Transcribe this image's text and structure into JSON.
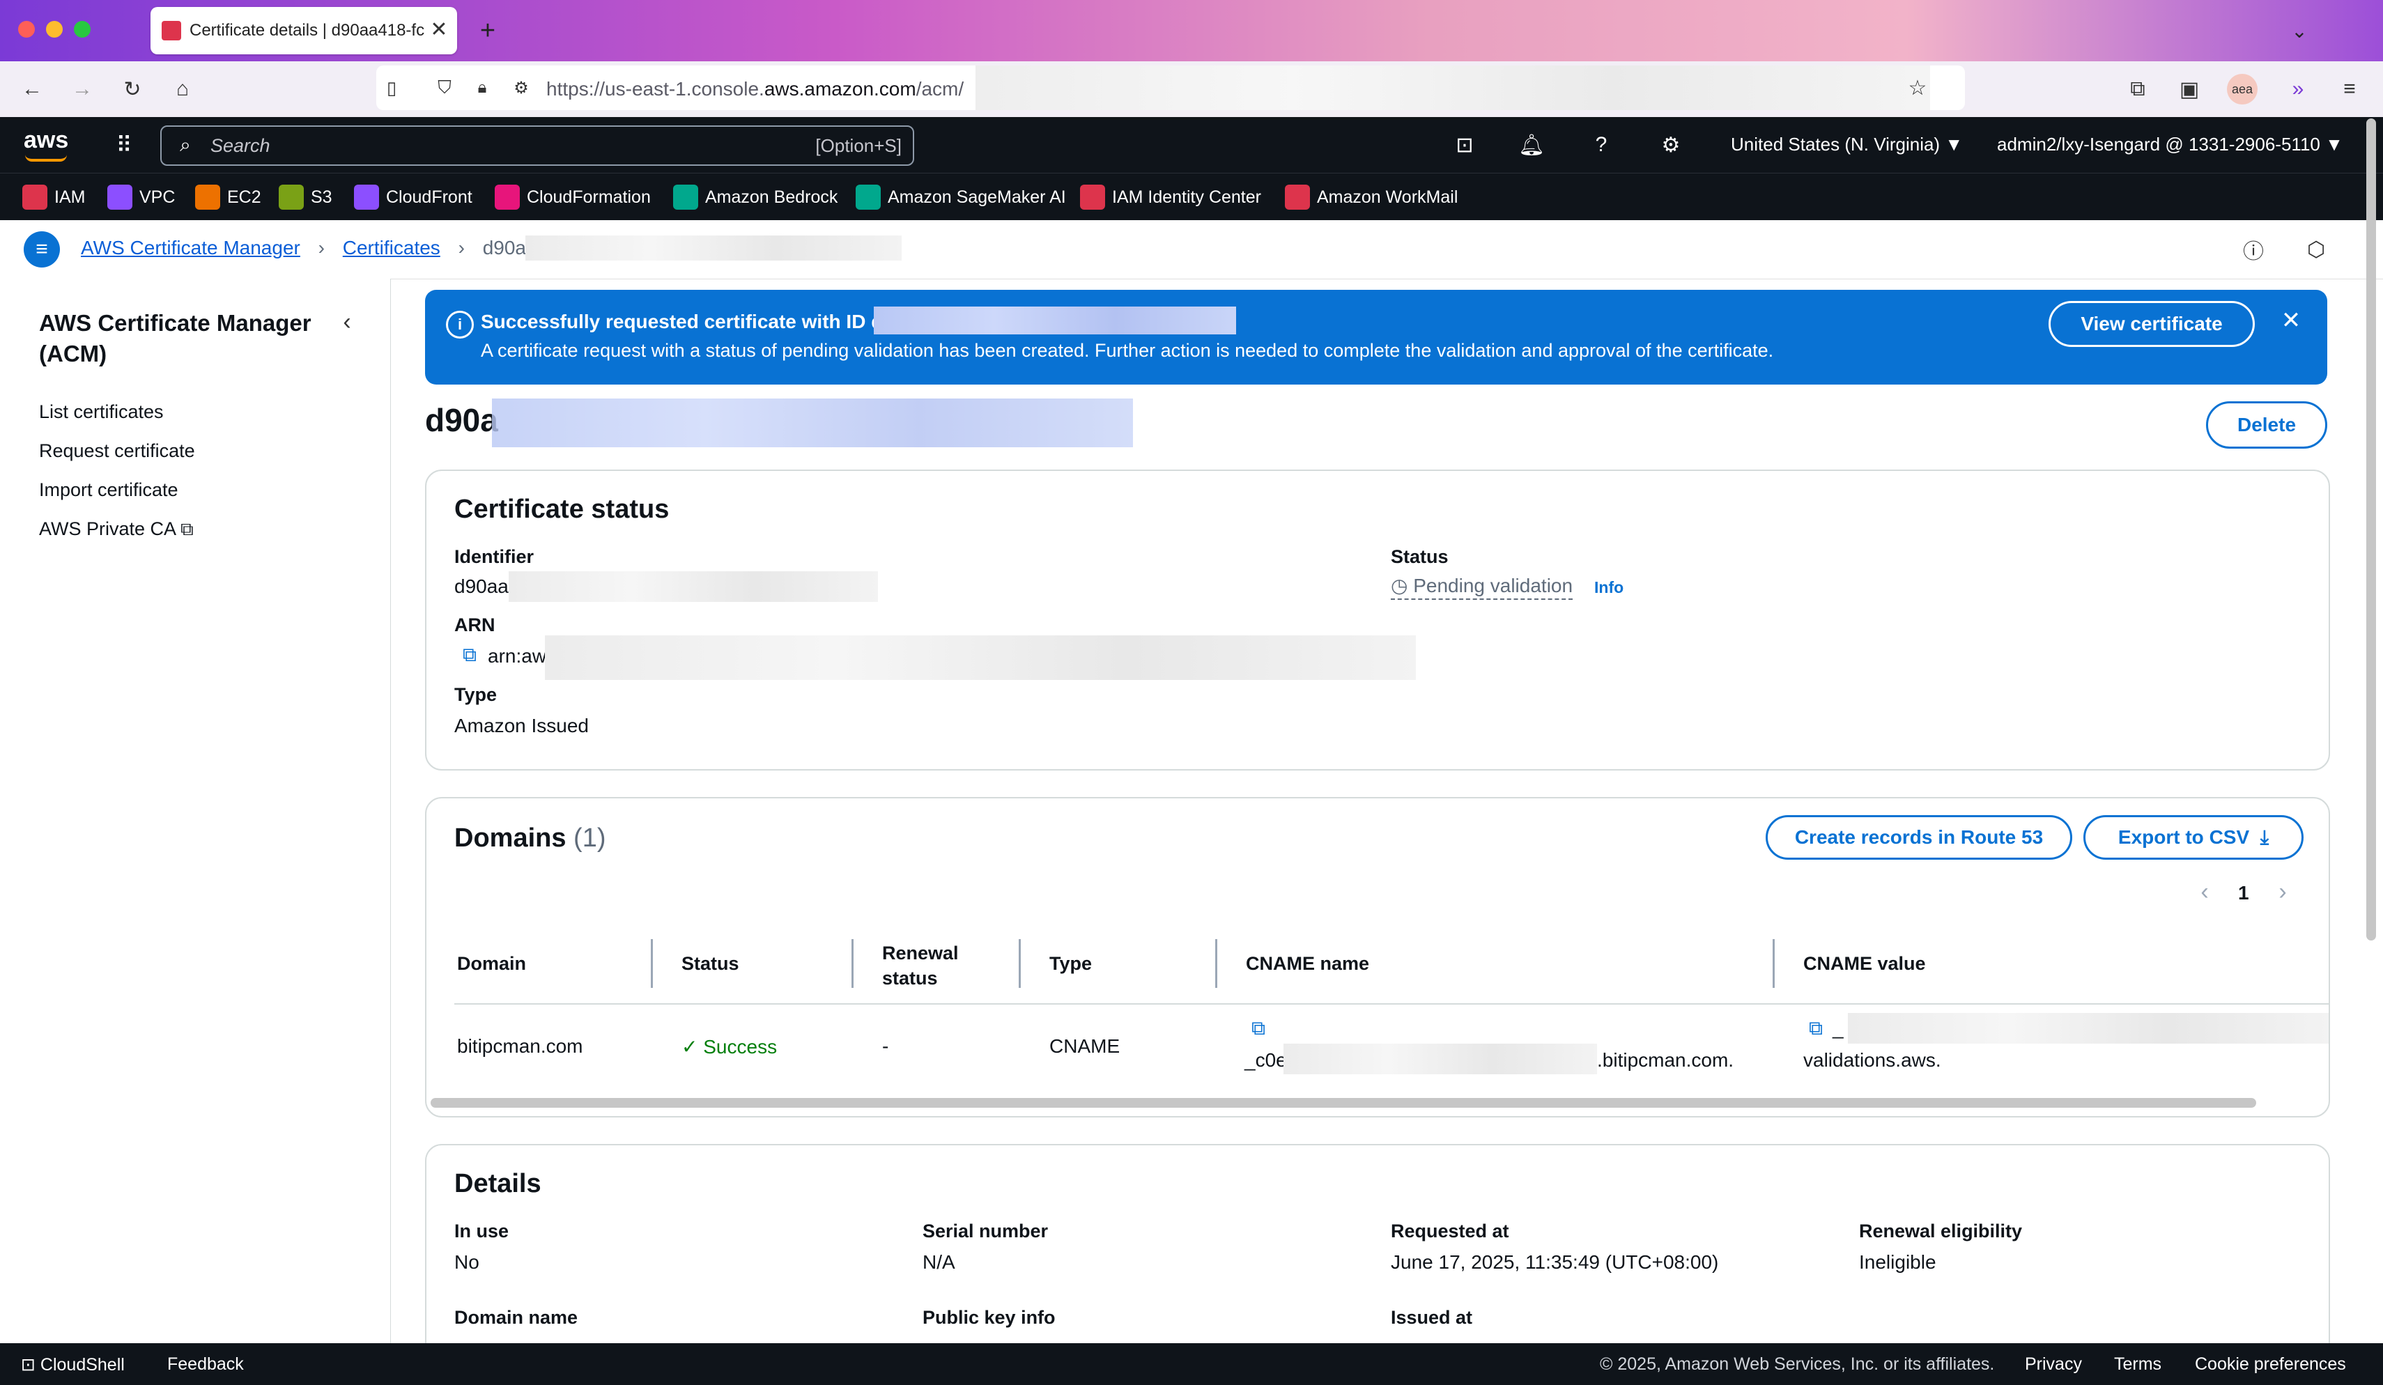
{
  "browser": {
    "tab_title": "Certificate details | d90aa418-fc",
    "url_prefix": "https://us-east-1.console.",
    "url_domain": "aws.amazon.com",
    "url_path": "/acm/"
  },
  "aws_nav": {
    "search_placeholder": "Search",
    "search_shortcut": "[Option+S]",
    "region": "United States (N. Virginia)",
    "account": "admin2/lxy-Isengard @ 1331-2906-5110"
  },
  "favorites": [
    {
      "label": "IAM",
      "color": "#dd344c"
    },
    {
      "label": "VPC",
      "color": "#8c4fff"
    },
    {
      "label": "EC2",
      "color": "#ed7100"
    },
    {
      "label": "S3",
      "color": "#7aa116"
    },
    {
      "label": "CloudFront",
      "color": "#8c4fff"
    },
    {
      "label": "CloudFormation",
      "color": "#e7157b"
    },
    {
      "label": "Amazon Bedrock",
      "color": "#01a88d"
    },
    {
      "label": "Amazon SageMaker AI",
      "color": "#01a88d"
    },
    {
      "label": "IAM Identity Center",
      "color": "#dd344c"
    },
    {
      "label": "Amazon WorkMail",
      "color": "#dd344c"
    }
  ],
  "breadcrumb": {
    "service": "AWS Certificate Manager",
    "section": "Certificates",
    "current": "d90aa"
  },
  "sidebar": {
    "title": "AWS Certificate Manager (ACM)",
    "items": [
      "List certificates",
      "Request certificate",
      "Import certificate",
      "AWS Private CA"
    ]
  },
  "banner": {
    "title": "Successfully requested certificate with ID d",
    "message": "A certificate request with a status of pending validation has been created. Further action is needed to complete the validation and approval of the certificate.",
    "button": "View certificate"
  },
  "page": {
    "title": "d90a",
    "delete_button": "Delete"
  },
  "certificate_status": {
    "heading": "Certificate status",
    "identifier_label": "Identifier",
    "identifier_value": "d90aa",
    "arn_label": "ARN",
    "arn_value": "arn:aw",
    "type_label": "Type",
    "type_value": "Amazon Issued",
    "status_label": "Status",
    "status_value": "Pending validation",
    "info_link": "Info"
  },
  "domains": {
    "heading": "Domains",
    "count": "(1)",
    "create_records_button": "Create records in Route 53",
    "export_button": "Export to CSV",
    "page_number": "1",
    "columns": [
      "Domain",
      "Status",
      "Renewal status",
      "Type",
      "CNAME name",
      "CNAME value"
    ],
    "rows": [
      {
        "domain": "bitipcman.com",
        "status": "Success",
        "renewal_status": "-",
        "type": "CNAME",
        "cname_name_prefix": "_c0e",
        "cname_name_suffix": ".bitipcman.com.",
        "cname_value_prefix": "_",
        "cname_value_suffix": "validations.aws."
      }
    ]
  },
  "details": {
    "heading": "Details",
    "in_use_label": "In use",
    "in_use_value": "No",
    "serial_label": "Serial number",
    "serial_value": "N/A",
    "requested_label": "Requested at",
    "requested_value": "June 17, 2025, 11:35:49 (UTC+08:00)",
    "renewal_label": "Renewal eligibility",
    "renewal_value": "Ineligible",
    "domain_name_label": "Domain name",
    "public_key_label": "Public key info",
    "issued_label": "Issued at"
  },
  "footer": {
    "cloudshell": "CloudShell",
    "feedback": "Feedback",
    "copyright": "© 2025, Amazon Web Services, Inc. or its affiliates.",
    "privacy": "Privacy",
    "terms": "Terms",
    "cookies": "Cookie preferences"
  },
  "colors": {
    "accent": "#0972d3",
    "success": "#037f0c",
    "nav_bg": "#0f141a"
  }
}
